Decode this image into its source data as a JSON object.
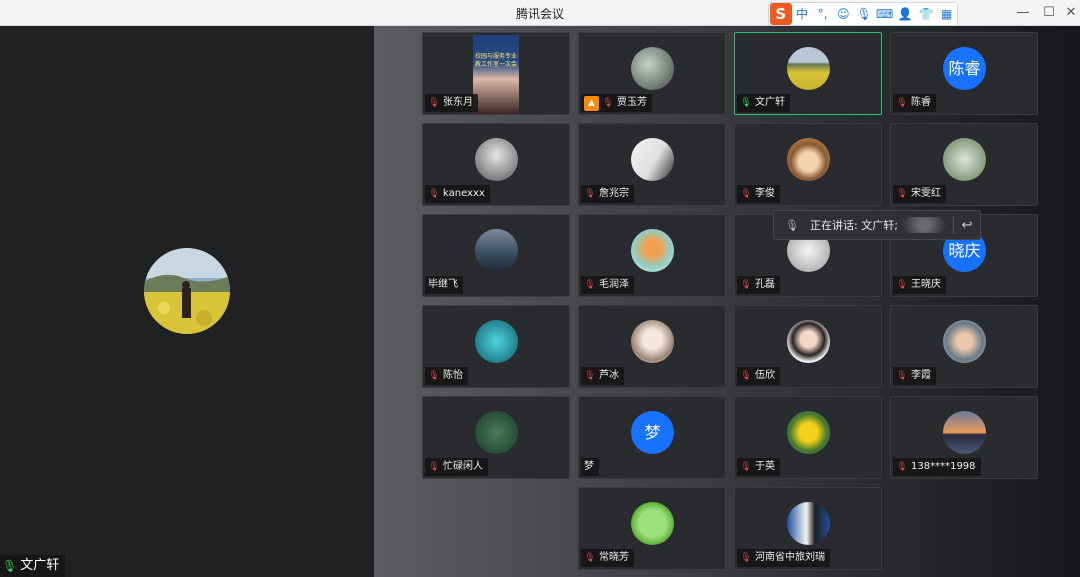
{
  "window": {
    "title": "腾讯会议"
  },
  "ime": {
    "logo": "S",
    "items": [
      "中",
      "°,",
      "☺",
      "🎙",
      "⌨",
      "👤",
      "👕",
      "▦"
    ]
  },
  "main_speaker": {
    "name": "文广轩"
  },
  "tooltip": {
    "text": "正在讲话: 文广轩;"
  },
  "participants": [
    {
      "name": "张东月",
      "type": "video",
      "caption": "校园与服务专业 教工作室一次会"
    },
    {
      "name": "贾玉芳",
      "type": "photo",
      "sharing": true
    },
    {
      "name": "文广轩",
      "type": "photo",
      "active": true
    },
    {
      "name": "陈睿",
      "type": "letter",
      "letter": "陈睿"
    },
    {
      "name": "kanexxx",
      "type": "photo"
    },
    {
      "name": "詹兆宗",
      "type": "photo"
    },
    {
      "name": "李俊",
      "type": "photo"
    },
    {
      "name": "宋雯红",
      "type": "photo"
    },
    {
      "name": "毕继飞",
      "type": "photo",
      "nomic": true
    },
    {
      "name": "毛润泽",
      "type": "photo"
    },
    {
      "name": "孔磊",
      "type": "photo"
    },
    {
      "name": "王晓庆",
      "type": "letter",
      "letter": "晓庆"
    },
    {
      "name": "陈怡",
      "type": "photo"
    },
    {
      "name": "芦冰",
      "type": "photo"
    },
    {
      "name": "伍欣",
      "type": "photo"
    },
    {
      "name": "李霞",
      "type": "photo"
    },
    {
      "name": "忙碌闲人",
      "type": "photo"
    },
    {
      "name": "梦",
      "type": "letter",
      "letter": "梦",
      "nomic": true
    },
    {
      "name": "于英",
      "type": "photo"
    },
    {
      "name": "138****1998",
      "type": "photo"
    },
    {
      "name": "常晓芳",
      "type": "photo"
    },
    {
      "name": "河南省中旅刘瑞",
      "type": "photo"
    }
  ],
  "colors": {
    "accent": "#1672ff",
    "active_border": "#2fbf71",
    "mic_on": "#3ecf5a",
    "mic_muted": "#d24a4a"
  }
}
